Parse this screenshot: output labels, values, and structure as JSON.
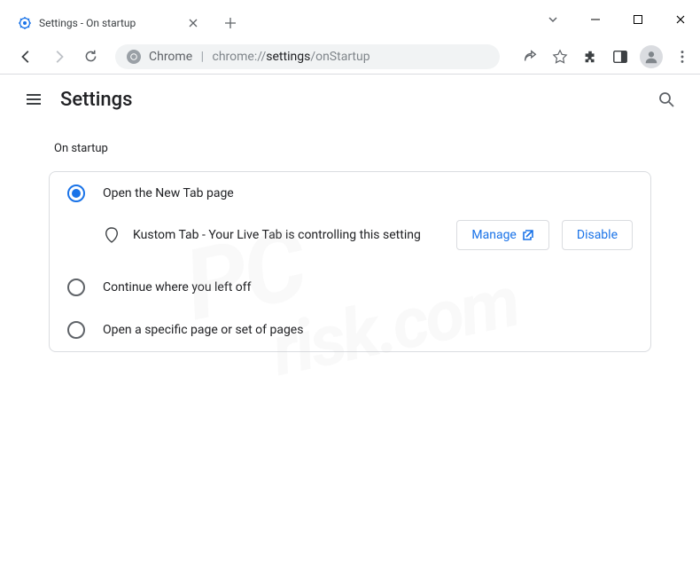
{
  "window": {
    "tab_title": "Settings - On startup"
  },
  "omnibox": {
    "scheme_label": "Chrome",
    "url_dim": "chrome://",
    "url_bold": "settings",
    "url_rest": "/onStartup"
  },
  "settings": {
    "page_title": "Settings",
    "section_title": "On startup",
    "options": {
      "open_new_tab": "Open the New Tab page",
      "continue": "Continue where you left off",
      "specific": "Open a specific page or set of pages"
    },
    "extension_notice": "Kustom Tab - Your Live Tab is controlling this setting",
    "manage_label": "Manage",
    "disable_label": "Disable"
  },
  "watermark": {
    "line1": "PC",
    "line2": "risk.com"
  }
}
